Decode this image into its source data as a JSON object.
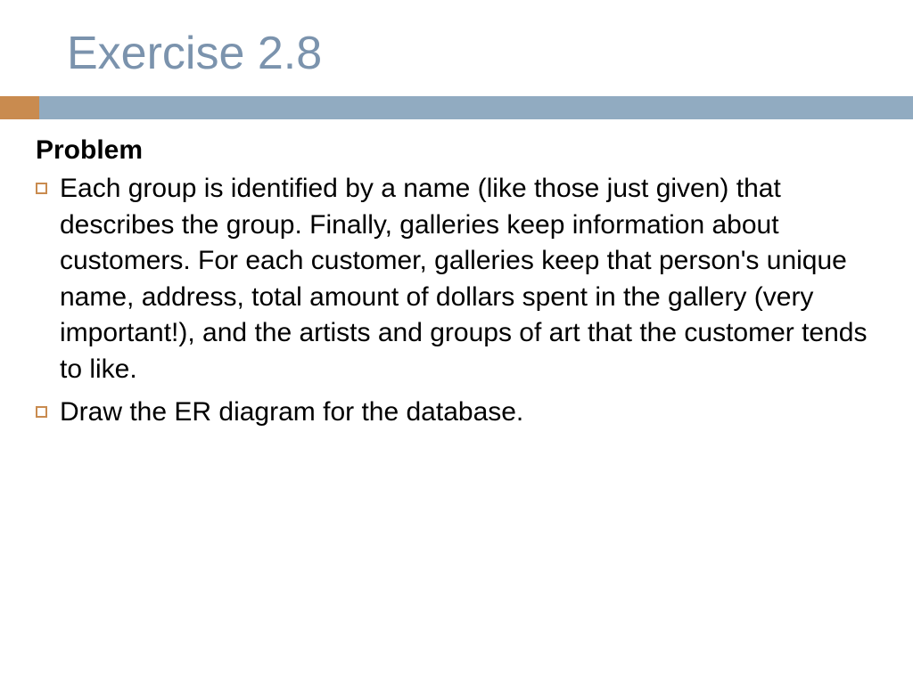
{
  "title": "Exercise 2.8",
  "problem_label": "Problem",
  "bullets": [
    "Each group is identified by a name (like those just given) that describes the group. Finally, galleries keep information about customers. For each customer, galleries keep that person's unique name, address, total amount of dollars spent in the gallery (very important!), and the artists and groups of art that the customer tends to like.",
    "Draw the ER diagram for the database."
  ]
}
